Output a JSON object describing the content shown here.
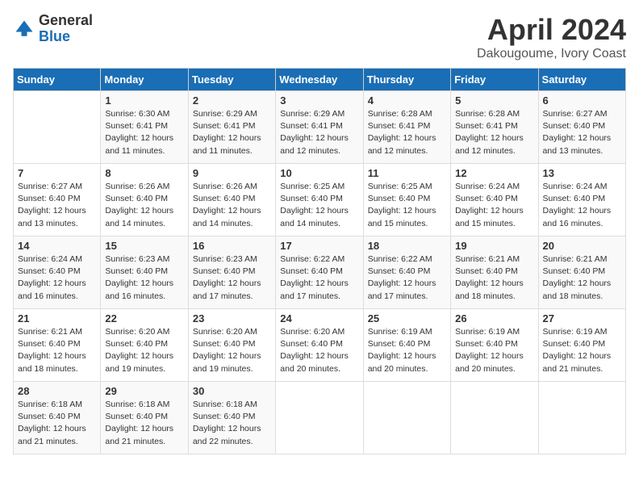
{
  "logo": {
    "general": "General",
    "blue": "Blue"
  },
  "header": {
    "month": "April 2024",
    "location": "Dakougoume, Ivory Coast"
  },
  "days_of_week": [
    "Sunday",
    "Monday",
    "Tuesday",
    "Wednesday",
    "Thursday",
    "Friday",
    "Saturday"
  ],
  "weeks": [
    [
      {
        "num": "",
        "info": ""
      },
      {
        "num": "1",
        "info": "Sunrise: 6:30 AM\nSunset: 6:41 PM\nDaylight: 12 hours\nand 11 minutes."
      },
      {
        "num": "2",
        "info": "Sunrise: 6:29 AM\nSunset: 6:41 PM\nDaylight: 12 hours\nand 11 minutes."
      },
      {
        "num": "3",
        "info": "Sunrise: 6:29 AM\nSunset: 6:41 PM\nDaylight: 12 hours\nand 12 minutes."
      },
      {
        "num": "4",
        "info": "Sunrise: 6:28 AM\nSunset: 6:41 PM\nDaylight: 12 hours\nand 12 minutes."
      },
      {
        "num": "5",
        "info": "Sunrise: 6:28 AM\nSunset: 6:41 PM\nDaylight: 12 hours\nand 12 minutes."
      },
      {
        "num": "6",
        "info": "Sunrise: 6:27 AM\nSunset: 6:40 PM\nDaylight: 12 hours\nand 13 minutes."
      }
    ],
    [
      {
        "num": "7",
        "info": "Sunrise: 6:27 AM\nSunset: 6:40 PM\nDaylight: 12 hours\nand 13 minutes."
      },
      {
        "num": "8",
        "info": "Sunrise: 6:26 AM\nSunset: 6:40 PM\nDaylight: 12 hours\nand 14 minutes."
      },
      {
        "num": "9",
        "info": "Sunrise: 6:26 AM\nSunset: 6:40 PM\nDaylight: 12 hours\nand 14 minutes."
      },
      {
        "num": "10",
        "info": "Sunrise: 6:25 AM\nSunset: 6:40 PM\nDaylight: 12 hours\nand 14 minutes."
      },
      {
        "num": "11",
        "info": "Sunrise: 6:25 AM\nSunset: 6:40 PM\nDaylight: 12 hours\nand 15 minutes."
      },
      {
        "num": "12",
        "info": "Sunrise: 6:24 AM\nSunset: 6:40 PM\nDaylight: 12 hours\nand 15 minutes."
      },
      {
        "num": "13",
        "info": "Sunrise: 6:24 AM\nSunset: 6:40 PM\nDaylight: 12 hours\nand 16 minutes."
      }
    ],
    [
      {
        "num": "14",
        "info": "Sunrise: 6:24 AM\nSunset: 6:40 PM\nDaylight: 12 hours\nand 16 minutes."
      },
      {
        "num": "15",
        "info": "Sunrise: 6:23 AM\nSunset: 6:40 PM\nDaylight: 12 hours\nand 16 minutes."
      },
      {
        "num": "16",
        "info": "Sunrise: 6:23 AM\nSunset: 6:40 PM\nDaylight: 12 hours\nand 17 minutes."
      },
      {
        "num": "17",
        "info": "Sunrise: 6:22 AM\nSunset: 6:40 PM\nDaylight: 12 hours\nand 17 minutes."
      },
      {
        "num": "18",
        "info": "Sunrise: 6:22 AM\nSunset: 6:40 PM\nDaylight: 12 hours\nand 17 minutes."
      },
      {
        "num": "19",
        "info": "Sunrise: 6:21 AM\nSunset: 6:40 PM\nDaylight: 12 hours\nand 18 minutes."
      },
      {
        "num": "20",
        "info": "Sunrise: 6:21 AM\nSunset: 6:40 PM\nDaylight: 12 hours\nand 18 minutes."
      }
    ],
    [
      {
        "num": "21",
        "info": "Sunrise: 6:21 AM\nSunset: 6:40 PM\nDaylight: 12 hours\nand 18 minutes."
      },
      {
        "num": "22",
        "info": "Sunrise: 6:20 AM\nSunset: 6:40 PM\nDaylight: 12 hours\nand 19 minutes."
      },
      {
        "num": "23",
        "info": "Sunrise: 6:20 AM\nSunset: 6:40 PM\nDaylight: 12 hours\nand 19 minutes."
      },
      {
        "num": "24",
        "info": "Sunrise: 6:20 AM\nSunset: 6:40 PM\nDaylight: 12 hours\nand 20 minutes."
      },
      {
        "num": "25",
        "info": "Sunrise: 6:19 AM\nSunset: 6:40 PM\nDaylight: 12 hours\nand 20 minutes."
      },
      {
        "num": "26",
        "info": "Sunrise: 6:19 AM\nSunset: 6:40 PM\nDaylight: 12 hours\nand 20 minutes."
      },
      {
        "num": "27",
        "info": "Sunrise: 6:19 AM\nSunset: 6:40 PM\nDaylight: 12 hours\nand 21 minutes."
      }
    ],
    [
      {
        "num": "28",
        "info": "Sunrise: 6:18 AM\nSunset: 6:40 PM\nDaylight: 12 hours\nand 21 minutes."
      },
      {
        "num": "29",
        "info": "Sunrise: 6:18 AM\nSunset: 6:40 PM\nDaylight: 12 hours\nand 21 minutes."
      },
      {
        "num": "30",
        "info": "Sunrise: 6:18 AM\nSunset: 6:40 PM\nDaylight: 12 hours\nand 22 minutes."
      },
      {
        "num": "",
        "info": ""
      },
      {
        "num": "",
        "info": ""
      },
      {
        "num": "",
        "info": ""
      },
      {
        "num": "",
        "info": ""
      }
    ]
  ]
}
